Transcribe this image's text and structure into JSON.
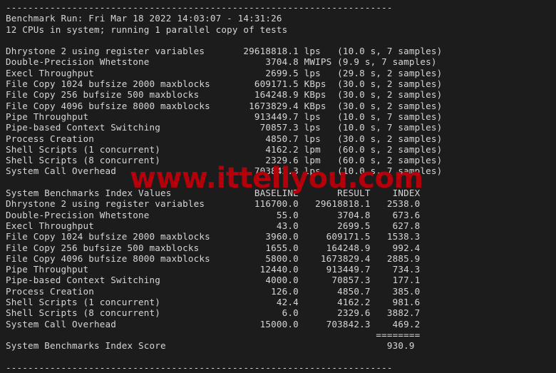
{
  "terminal": {
    "background_color": "#1c1c1c",
    "text_color": "#d6d6d6",
    "rule_top": "------------------------------------------------------------------------",
    "rule_bottom": "------------------------------------------------------------------------",
    "header": {
      "run_line": "Benchmark Run: Fri Mar 18 2022 14:03:07 - 14:31:26",
      "cpu_line": "12 CPUs in system; running 1 parallel copy of tests"
    },
    "raw_results": [
      {
        "name": "Dhrystone 2 using register variables",
        "value": "29618818.1",
        "unit": "lps",
        "timing": "(10.0 s, 7 samples)"
      },
      {
        "name": "Double-Precision Whetstone",
        "value": "3704.8",
        "unit": "MWIPS",
        "timing": "(9.9 s, 7 samples)"
      },
      {
        "name": "Execl Throughput",
        "value": "2699.5",
        "unit": "lps",
        "timing": "(29.8 s, 2 samples)"
      },
      {
        "name": "File Copy 1024 bufsize 2000 maxblocks",
        "value": "609171.5",
        "unit": "KBps",
        "timing": "(30.0 s, 2 samples)"
      },
      {
        "name": "File Copy 256 bufsize 500 maxblocks",
        "value": "164248.9",
        "unit": "KBps",
        "timing": "(30.0 s, 2 samples)"
      },
      {
        "name": "File Copy 4096 bufsize 8000 maxblocks",
        "value": "1673829.4",
        "unit": "KBps",
        "timing": "(30.0 s, 2 samples)"
      },
      {
        "name": "Pipe Throughput",
        "value": "913449.7",
        "unit": "lps",
        "timing": "(10.0 s, 7 samples)"
      },
      {
        "name": "Pipe-based Context Switching",
        "value": "70857.3",
        "unit": "lps",
        "timing": "(10.0 s, 7 samples)"
      },
      {
        "name": "Process Creation",
        "value": "4850.7",
        "unit": "lps",
        "timing": "(30.0 s, 2 samples)"
      },
      {
        "name": "Shell Scripts (1 concurrent)",
        "value": "4162.2",
        "unit": "lpm",
        "timing": "(60.0 s, 2 samples)"
      },
      {
        "name": "Shell Scripts (8 concurrent)",
        "value": "2329.6",
        "unit": "lpm",
        "timing": "(60.0 s, 2 samples)"
      },
      {
        "name": "System Call Overhead",
        "value": "703842.3",
        "unit": "lps",
        "timing": "(10.0 s, 7 samples)"
      }
    ],
    "index_table": {
      "title": "System Benchmarks Index Values",
      "columns": [
        "BASELINE",
        "RESULT",
        "INDEX"
      ],
      "rows": [
        {
          "name": "Dhrystone 2 using register variables",
          "baseline": "116700.0",
          "result": "29618818.1",
          "index": "2538.0"
        },
        {
          "name": "Double-Precision Whetstone",
          "baseline": "55.0",
          "result": "3704.8",
          "index": "673.6"
        },
        {
          "name": "Execl Throughput",
          "baseline": "43.0",
          "result": "2699.5",
          "index": "627.8"
        },
        {
          "name": "File Copy 1024 bufsize 2000 maxblocks",
          "baseline": "3960.0",
          "result": "609171.5",
          "index": "1538.3"
        },
        {
          "name": "File Copy 256 bufsize 500 maxblocks",
          "baseline": "1655.0",
          "result": "164248.9",
          "index": "992.4"
        },
        {
          "name": "File Copy 4096 bufsize 8000 maxblocks",
          "baseline": "5800.0",
          "result": "1673829.4",
          "index": "2885.9"
        },
        {
          "name": "Pipe Throughput",
          "baseline": "12440.0",
          "result": "913449.7",
          "index": "734.3"
        },
        {
          "name": "Pipe-based Context Switching",
          "baseline": "4000.0",
          "result": "70857.3",
          "index": "177.1"
        },
        {
          "name": "Process Creation",
          "baseline": "126.0",
          "result": "4850.7",
          "index": "385.0"
        },
        {
          "name": "Shell Scripts (1 concurrent)",
          "baseline": "42.4",
          "result": "4162.2",
          "index": "981.6"
        },
        {
          "name": "Shell Scripts (8 concurrent)",
          "baseline": "6.0",
          "result": "2329.6",
          "index": "3882.7"
        },
        {
          "name": "System Call Overhead",
          "baseline": "15000.0",
          "result": "703842.3",
          "index": "469.2"
        }
      ],
      "separator": "========",
      "score_label": "System Benchmarks Index Score",
      "score_value": "930.9"
    }
  },
  "watermark": {
    "text": "www.ittellyou.com",
    "color": "#b3000b"
  },
  "lines": {
    "rule_top": "----------------------------------------------------------------------",
    "run": "Benchmark Run: Fri Mar 18 2022 14:03:07 - 14:31:26",
    "cpus": "12 CPUs in system; running 1 parallel copy of tests",
    "blank": " ",
    "r1": "Dhrystone 2 using register variables       29618818.1 lps   (10.0 s, 7 samples)",
    "r2": "Double-Precision Whetstone                     3704.8 MWIPS (9.9 s, 7 samples)",
    "r3": "Execl Throughput                               2699.5 lps   (29.8 s, 2 samples)",
    "r4": "File Copy 1024 bufsize 2000 maxblocks        609171.5 KBps  (30.0 s, 2 samples)",
    "r5": "File Copy 256 bufsize 500 maxblocks          164248.9 KBps  (30.0 s, 2 samples)",
    "r6": "File Copy 4096 bufsize 8000 maxblocks       1673829.4 KBps  (30.0 s, 2 samples)",
    "r7": "Pipe Throughput                              913449.7 lps   (10.0 s, 7 samples)",
    "r8": "Pipe-based Context Switching                  70857.3 lps   (10.0 s, 7 samples)",
    "r9": "Process Creation                               4850.7 lps   (30.0 s, 2 samples)",
    "r10": "Shell Scripts (1 concurrent)                   4162.2 lpm   (60.0 s, 2 samples)",
    "r11": "Shell Scripts (8 concurrent)                   2329.6 lpm   (60.0 s, 2 samples)",
    "r12": "System Call Overhead                         703842.3 lps   (10.0 s, 7 samples)",
    "ihdr": "System Benchmarks Index Values               BASELINE       RESULT    INDEX",
    "i1": "Dhrystone 2 using register variables         116700.0   29618818.1   2538.0",
    "i2": "Double-Precision Whetstone                       55.0       3704.8    673.6",
    "i3": "Execl Throughput                                 43.0       2699.5    627.8",
    "i4": "File Copy 1024 bufsize 2000 maxblocks          3960.0     609171.5   1538.3",
    "i5": "File Copy 256 bufsize 500 maxblocks            1655.0     164248.9    992.4",
    "i6": "File Copy 4096 bufsize 8000 maxblocks          5800.0    1673829.4   2885.9",
    "i7": "Pipe Throughput                               12440.0     913449.7    734.3",
    "i8": "Pipe-based Context Switching                   4000.0      70857.3    177.1",
    "i9": "Process Creation                                126.0       4850.7    385.0",
    "i10": "Shell Scripts (1 concurrent)                     42.4       4162.2    981.6",
    "i11": "Shell Scripts (8 concurrent)                      6.0       2329.6   3882.7",
    "i12": "System Call Overhead                          15000.0     703842.3    469.2",
    "sep": "                                                                   ========",
    "score": "System Benchmarks Index Score                                        930.9",
    "rule_bottom": "----------------------------------------------------------------------"
  }
}
